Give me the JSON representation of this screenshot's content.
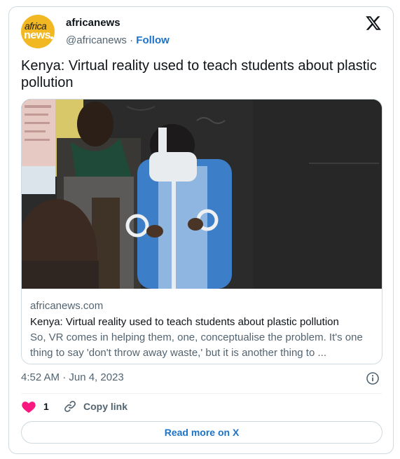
{
  "account": {
    "name": "africanews",
    "handle": "@africanews",
    "separator": " · ",
    "follow_label": "Follow",
    "avatar_line1": "africa",
    "avatar_line2": "news"
  },
  "tweet": {
    "text": "Kenya: Virtual reality used to teach students about plastic pollution"
  },
  "link_card": {
    "domain": "africanews.com",
    "title": "Kenya: Virtual reality used to teach students about plastic pollution",
    "description": "So, VR comes in helping them, one, conceptualise the problem. It's one thing to say 'don't throw away waste,' but it is another thing to ..."
  },
  "meta": {
    "timestamp": "4:52 AM · Jun 4, 2023"
  },
  "actions": {
    "like_count": "1",
    "copy_link_label": "Copy link",
    "read_more_label": "Read more on X"
  },
  "colors": {
    "link_blue": "#1d73c7",
    "like_pink": "#f91880",
    "brand_yellow": "#f2b824"
  },
  "icons": [
    "x-logo-icon",
    "info-icon",
    "heart-icon",
    "link-icon"
  ]
}
